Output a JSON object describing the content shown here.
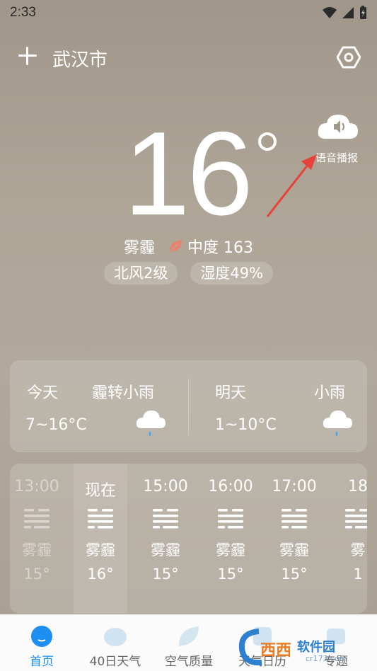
{
  "status_bar": {
    "time": "2:33"
  },
  "header": {
    "city": "武汉市"
  },
  "current": {
    "temperature": "16",
    "condition": "雾霾",
    "aqi": "中度 163",
    "wind": "北风2级",
    "humidity": "湿度49%",
    "voice_label": "语音播报"
  },
  "forecast": {
    "today": {
      "label": "今天",
      "condition": "霾转小雨",
      "temps": "7~16°C",
      "icon": "rain-cloud-icon"
    },
    "tomorrow": {
      "label": "明天",
      "condition": "小雨",
      "temps": "1~10°C",
      "icon": "rain-cloud-icon"
    }
  },
  "hourly": [
    {
      "time": "13:00",
      "condition": "雾霾",
      "temp": "15°",
      "state": "past"
    },
    {
      "time": "现在",
      "condition": "雾霾",
      "temp": "16°",
      "state": "now"
    },
    {
      "time": "15:00",
      "condition": "雾霾",
      "temp": "15°",
      "state": "future"
    },
    {
      "time": "16:00",
      "condition": "雾霾",
      "temp": "15°",
      "state": "future"
    },
    {
      "time": "17:00",
      "condition": "雾霾",
      "temp": "15°",
      "state": "future"
    },
    {
      "time": "18",
      "condition": "雾",
      "temp": "1",
      "state": "future"
    }
  ],
  "bottom_nav": [
    {
      "label": "首页",
      "active": true
    },
    {
      "label": "40日天气",
      "active": false
    },
    {
      "label": "空气质量",
      "active": false
    },
    {
      "label": "天气日历",
      "active": false
    },
    {
      "label": "专题",
      "active": false
    }
  ],
  "watermark": {
    "text": "软件园",
    "site": "cr173.com"
  },
  "colors": {
    "accent": "#1e8ff0",
    "aqi_leaf": "#e8826a"
  }
}
